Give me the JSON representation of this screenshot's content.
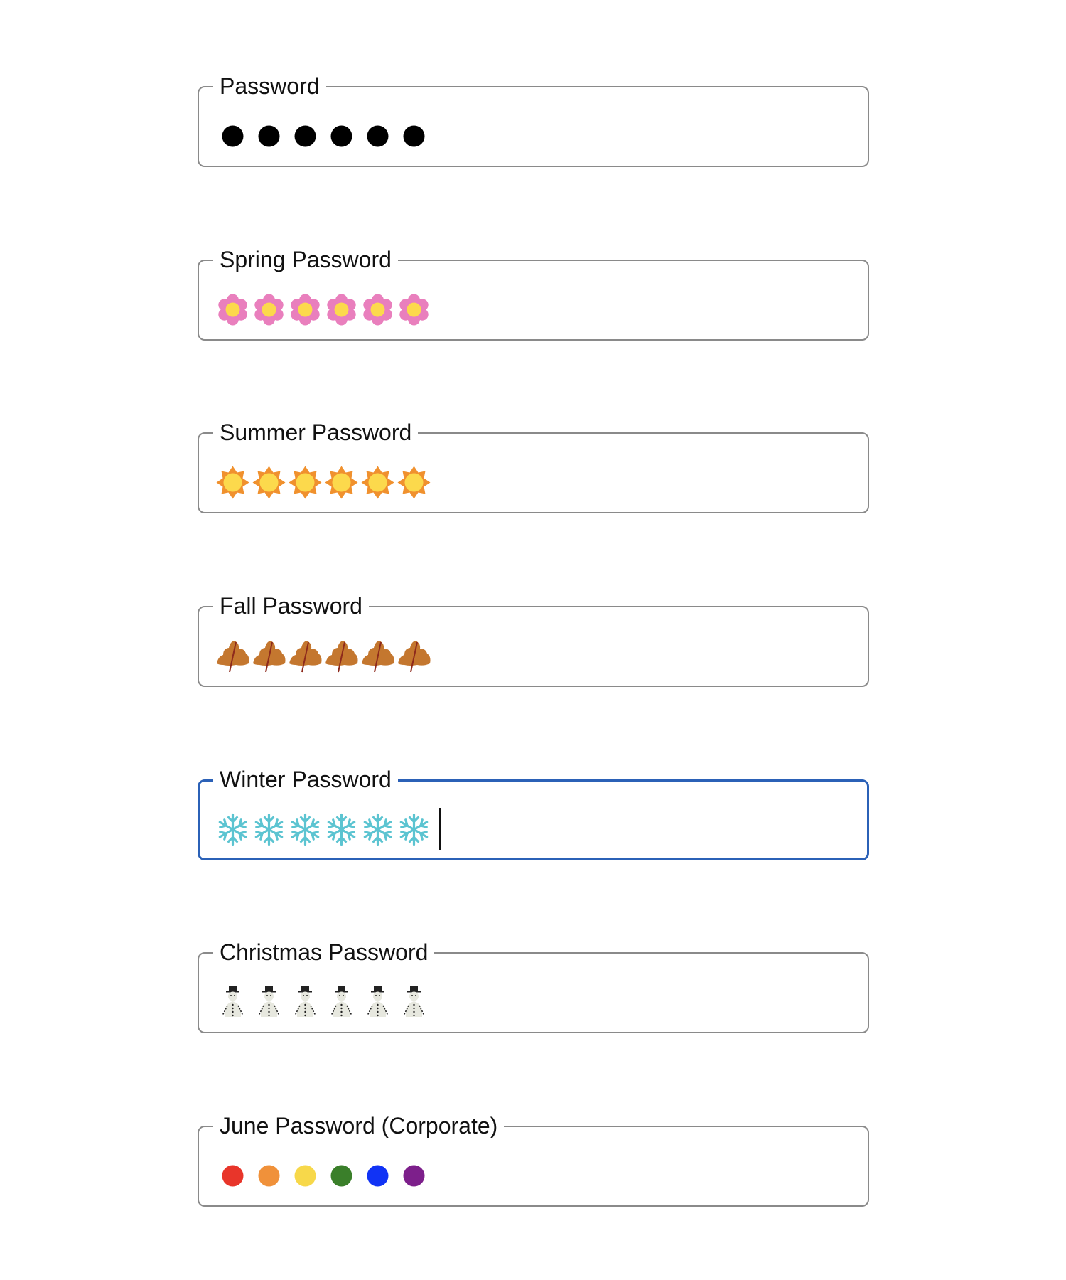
{
  "fields": [
    {
      "label": "Password",
      "value": "●●●●●●",
      "mask": "black-dot-icon",
      "length": 6,
      "focused": false
    },
    {
      "label": "Spring Password",
      "value": "🌼🌼🌼🌼🌼🌼",
      "mask": "pink-flower-icon",
      "length": 6,
      "focused": false
    },
    {
      "label": "Summer Password",
      "value": "🌞🌞🌞🌞🌞🌞",
      "mask": "sun-icon",
      "length": 6,
      "focused": false
    },
    {
      "label": "Fall Password",
      "value": "🍂🍂🍂🍂🍂🍂",
      "mask": "autumn-leaf-icon",
      "length": 6,
      "focused": false
    },
    {
      "label": "Winter Password",
      "value": "❄❄❄❄❄❄",
      "mask": "snowflake-icon",
      "length": 6,
      "focused": true
    },
    {
      "label": "Christmas Password",
      "value": "⛄⛄⛄⛄⛄⛄",
      "mask": "snowman-icon",
      "length": 6,
      "focused": false
    },
    {
      "label": "June Password (Corporate)",
      "value": "●●●●●●",
      "mask": "rainbow-dot-icon",
      "length": 6,
      "focused": false
    }
  ],
  "colors": {
    "border": "#8a8a8a",
    "focus_border": "#2b61b7",
    "rainbow": [
      "#e8352a",
      "#f0913a",
      "#f7d84a",
      "#3a7f2a",
      "#1133f5",
      "#7d1f8b"
    ]
  }
}
